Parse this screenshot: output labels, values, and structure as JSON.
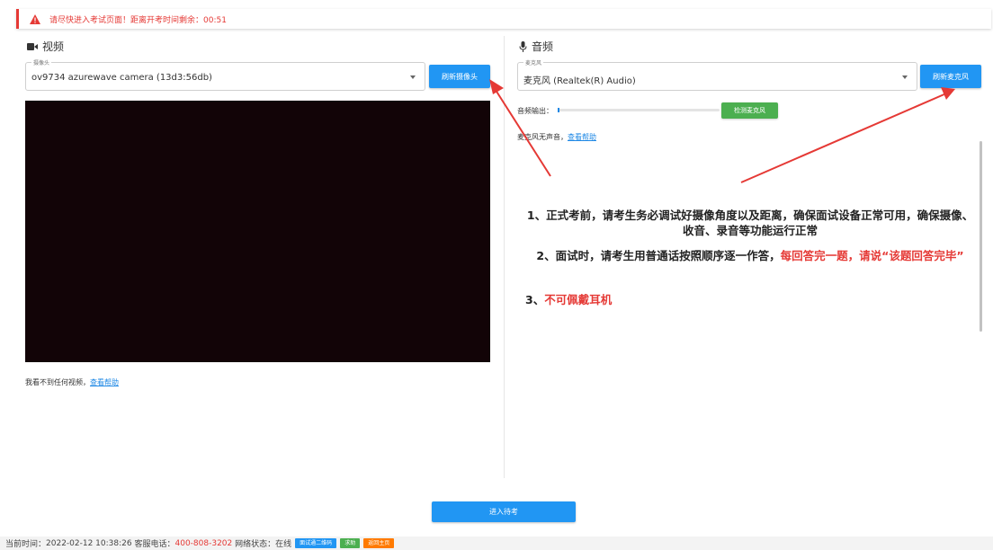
{
  "alert": {
    "icon": "warning-icon",
    "text": "请尽快进入考试页面！距离开考时间剩余：00:51",
    "color": "#e53935"
  },
  "video": {
    "title": "视频",
    "icon": "video-camera-icon",
    "camera_label": "摄像头",
    "camera_value": "ov9734 azurewave camera (13d3:56db)",
    "refresh_label": "刷新摄像头",
    "help_text": "我看不到任何视频，",
    "help_link": "查看帮助"
  },
  "audio": {
    "title": "音频",
    "icon": "microphone-icon",
    "mic_label": "麦克风",
    "mic_value": "麦克风 (Realtek(R) Audio)",
    "refresh_label": "刷新麦克风",
    "output_label": "音频输出：",
    "output_level": 0.01,
    "detect_label": "检测麦克风",
    "help_text": "麦克风无声音，",
    "help_link": "查看帮助"
  },
  "instructions": {
    "item1": "1、正式考前，请考生务必调试好摄像角度以及距离，确保面试设备正常可用，确保摄像、收音、录音等功能运行正常",
    "item2_prefix": "2、面试时，请考生用普通话按照顺序逐一作答，",
    "item2_red": "每回答完一题，请说“该题回答完毕”",
    "item3_prefix": "3、",
    "item3_red": "不可佩戴耳机"
  },
  "enter_button": "进入待考",
  "footer": {
    "time_label": "当前时间：",
    "time": "2022-02-12 10:38:26",
    "service_label": "客服电话：",
    "phone": "400-808-3202",
    "network_label": "网络状态：",
    "network": "在线",
    "btn_qr": "面试通二维码",
    "btn_help": "求助",
    "btn_home": "返回主页"
  },
  "colors": {
    "primary": "#2196f3",
    "success": "#4caf50",
    "danger": "#e53935",
    "orange": "#ff7a00",
    "video_bg": "#120407"
  }
}
